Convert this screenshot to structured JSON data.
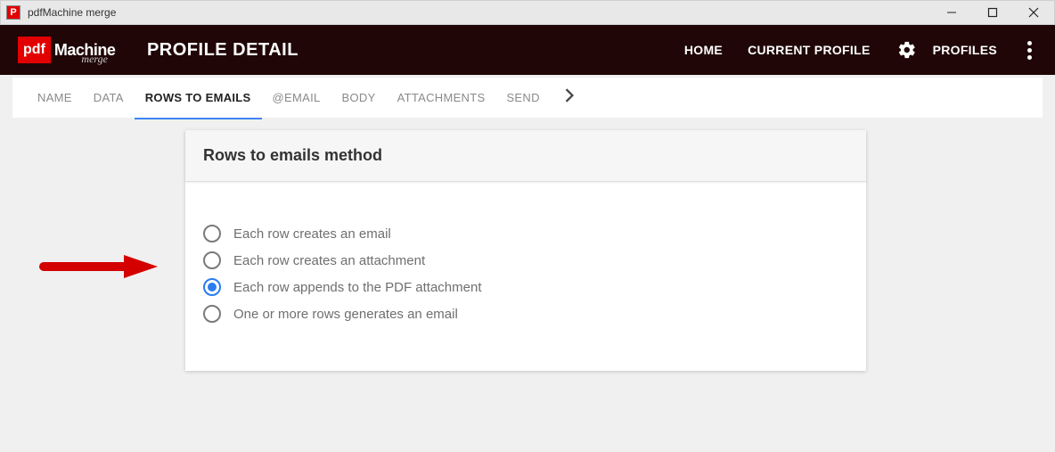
{
  "window": {
    "title": "pdfMachine merge"
  },
  "logo": {
    "pdf": "pdf",
    "machine": "Machine",
    "merge": "merge"
  },
  "header": {
    "title": "PROFILE DETAIL",
    "links": {
      "home": "HOME",
      "current_profile": "CURRENT PROFILE",
      "profiles": "PROFILES"
    }
  },
  "tabs": {
    "name": "NAME",
    "data": "DATA",
    "rows_to_emails": "ROWS TO EMAILS",
    "at_email": "@EMAIL",
    "body": "BODY",
    "attachments": "ATTACHMENTS",
    "send": "SEND"
  },
  "card": {
    "title": "Rows to emails method",
    "options": {
      "opt1": "Each row creates an email",
      "opt2": "Each row creates an attachment",
      "opt3": "Each row appends to the PDF attachment",
      "opt4": "One or more rows generates an email"
    }
  }
}
